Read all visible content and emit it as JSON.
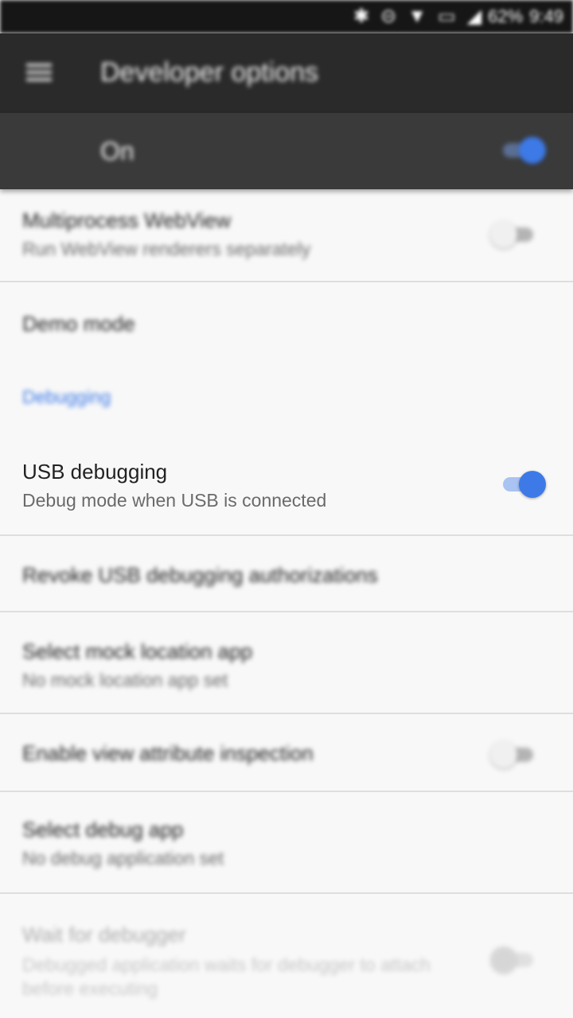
{
  "status_bar": {
    "battery": "62%",
    "time": "9:49",
    "icons": [
      "bluetooth-icon",
      "do-not-disturb-icon",
      "wifi-icon",
      "lte-icon",
      "signal-icon"
    ]
  },
  "toolbar": {
    "menu_icon": "menu-icon",
    "title": "Developer options"
  },
  "master_switch": {
    "label": "On",
    "checked": true
  },
  "items": [
    {
      "title": "Multiprocess WebView",
      "summary": "Run WebView renderers separately",
      "toggle": false
    },
    {
      "title": "Demo mode"
    },
    {
      "title": "USB debugging",
      "summary": "Debug mode when USB is connected",
      "toggle": true
    },
    {
      "title": "Revoke USB debugging authorizations"
    },
    {
      "title": "Select mock location app",
      "summary": "No mock location app set"
    },
    {
      "title": "Enable view attribute inspection",
      "toggle": false
    },
    {
      "title": "Select debug app",
      "summary": "No debug application set"
    },
    {
      "title": "Wait for debugger",
      "summary": "Debugged application waits for debugger to attach before executing",
      "toggle": false,
      "disabled": true
    }
  ],
  "section_header": "Debugging",
  "colors": {
    "accent": "#3d7ae7",
    "toolbar": "#2a2a2a",
    "master_bar": "#3a3a3a",
    "background": "#f8f8f8"
  }
}
